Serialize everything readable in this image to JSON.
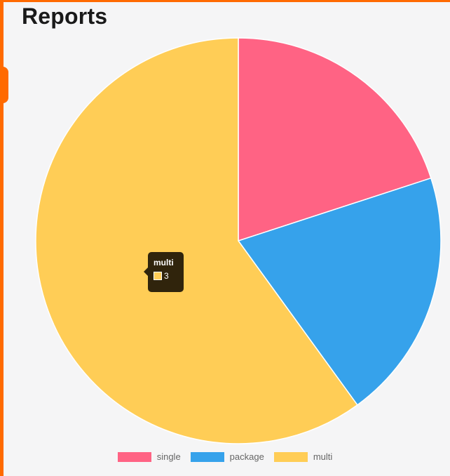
{
  "header": {
    "title": "Reports"
  },
  "tooltip": {
    "title": "multi",
    "value": "3",
    "color": "#ffcd56"
  },
  "chart_data": {
    "type": "pie",
    "title": "",
    "categories": [
      "single",
      "package",
      "multi"
    ],
    "values": [
      1,
      1,
      3
    ],
    "colors": [
      "#ff6384",
      "#36a2eb",
      "#ffcd56"
    ],
    "legend_position": "bottom",
    "start_angle_deg": -90,
    "direction": "clockwise"
  }
}
